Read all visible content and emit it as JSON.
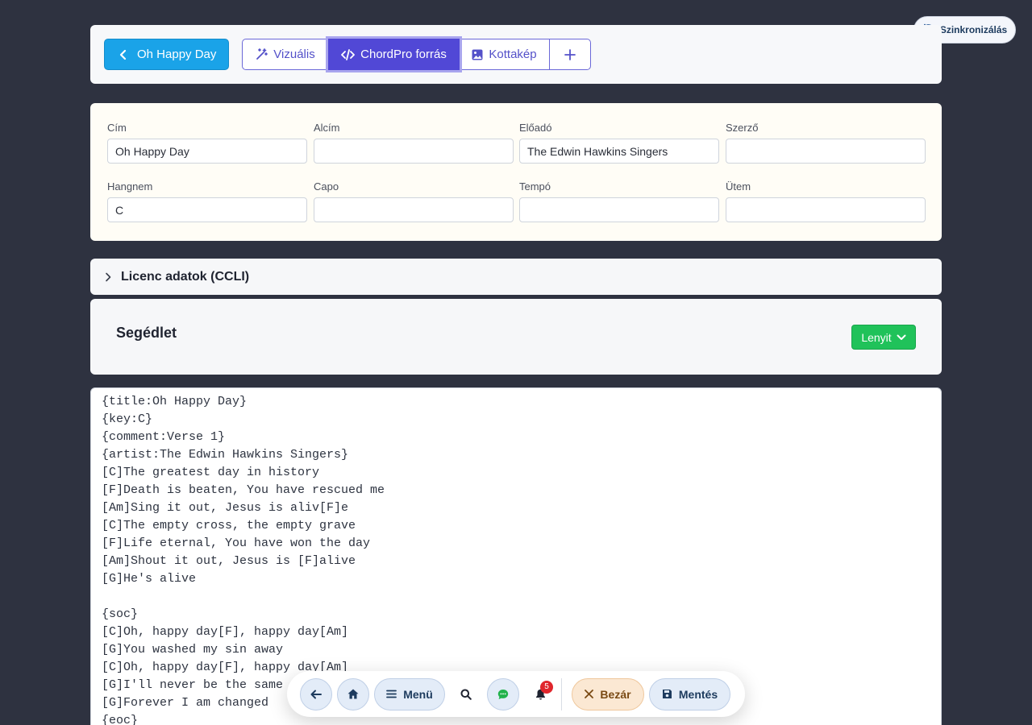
{
  "sync": {
    "label": "Szinkronizálás"
  },
  "toolbar": {
    "back_label": "Oh Happy Day",
    "tabs": [
      {
        "label": "Vizuális",
        "icon": "magic-wand-icon"
      },
      {
        "label": "ChordPro forrás",
        "icon": "code-icon",
        "active": true
      },
      {
        "label": "Kottakép",
        "icon": "image-icon"
      }
    ],
    "add_icon": "plus-icon"
  },
  "meta": {
    "fields": [
      {
        "label": "Cím",
        "value": "Oh Happy Day"
      },
      {
        "label": "Alcím",
        "value": ""
      },
      {
        "label": "Előadó",
        "value": "The Edwin Hawkins Singers"
      },
      {
        "label": "Szerző",
        "value": ""
      },
      {
        "label": "Hangnem",
        "value": "C"
      },
      {
        "label": "Capo",
        "value": ""
      },
      {
        "label": "Tempó",
        "value": ""
      },
      {
        "label": "Ütem",
        "value": ""
      }
    ]
  },
  "license": {
    "label": "Licenc adatok (CCLI)"
  },
  "helper": {
    "title": "Segédlet",
    "dropdown_label": "Lenyit"
  },
  "editor": {
    "lines": [
      "{title:Oh Happy Day}",
      "{key:C}",
      "{comment:Verse 1}",
      "{artist:The Edwin Hawkins Singers}",
      "[C]The greatest day in history",
      "[F]Death is beaten, You have rescued me",
      "[Am]Sing it out, Jesus is aliv[F]e",
      "[C]The empty cross, the empty grave",
      "[F]Life eternal, You have won the day",
      "[Am]Shout it out, Jesus is [F]alive",
      "[G]He's alive",
      "",
      "{soc}",
      "[C]Oh, happy day[F], happy day[Am]",
      "[G]You washed my sin away",
      "[C]Oh, happy day[F], happy day[Am]",
      "[G]I'll never be the same",
      "[G]Forever I am changed",
      "{eoc}"
    ]
  },
  "bottom_bar": {
    "menu_label": "Menü",
    "notification_count": "5",
    "close_label": "Bezár",
    "save_label": "Mentés"
  },
  "colors": {
    "background": "#2e3240",
    "primary": "#1aa3e8",
    "active_tab": "#5148d6",
    "success": "#20c25a",
    "badge": "#e0262c"
  }
}
